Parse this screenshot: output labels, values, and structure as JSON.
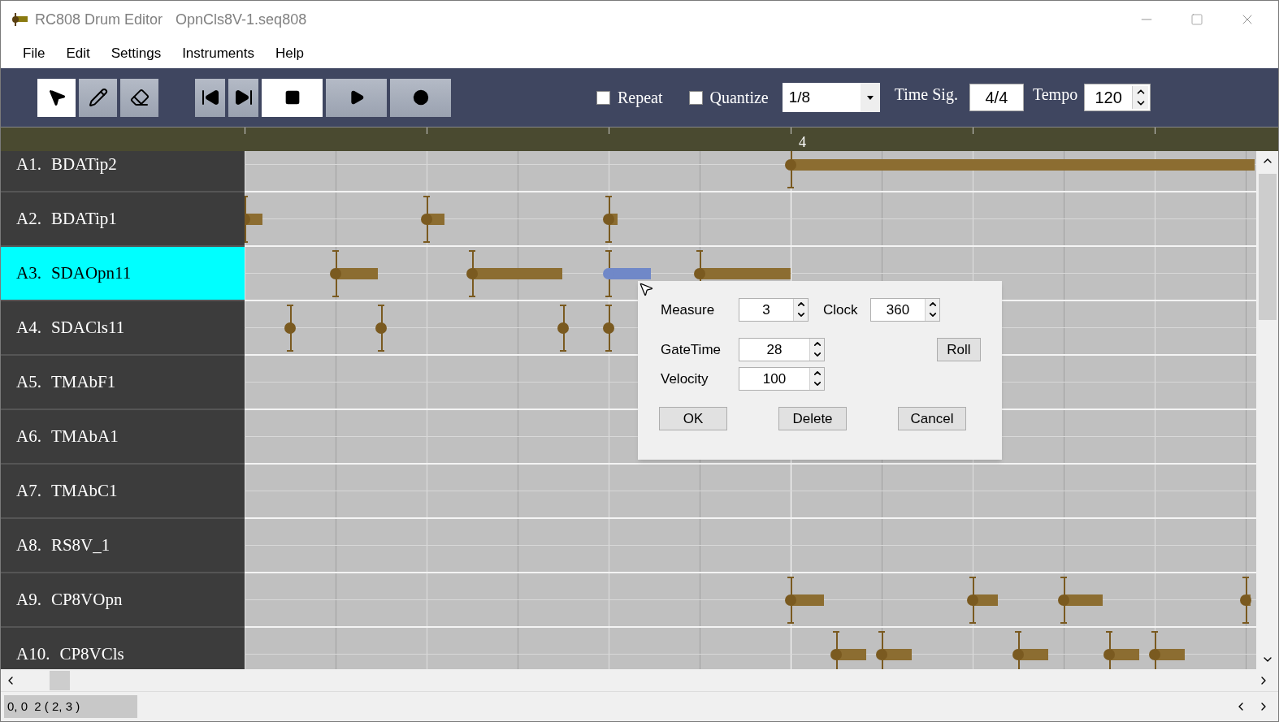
{
  "window": {
    "app_title": "RC808 Drum Editor",
    "file_name": "OpnCls8V-1.seq808"
  },
  "menu": [
    "File",
    "Edit",
    "Settings",
    "Instruments",
    "Help"
  ],
  "tools": [
    {
      "kind": "select",
      "selected": true
    },
    {
      "kind": "pencil",
      "selected": false
    },
    {
      "kind": "eraser",
      "selected": false
    }
  ],
  "transport": [
    {
      "kind": "skip-back",
      "active": false
    },
    {
      "kind": "skip-forward",
      "active": false
    },
    {
      "kind": "stop",
      "active": true
    },
    {
      "kind": "play",
      "active": false
    },
    {
      "kind": "record",
      "active": false
    }
  ],
  "options": [
    {
      "label": "Repeat",
      "checked": false
    },
    {
      "label": "Quantize",
      "checked": false
    }
  ],
  "quantize_value": "1/8",
  "time_sig": {
    "label": "Time Sig.",
    "value": "4/4"
  },
  "tempo": {
    "label": "Tempo",
    "value": "120"
  },
  "measure_label": "4",
  "rows": [
    {
      "id": "A1.",
      "name": "BDATip2",
      "selected": false,
      "notes": [
        {
          "selected": false
        }
      ]
    },
    {
      "id": "A2.",
      "name": "BDATip1",
      "selected": false,
      "notes": [
        {
          "selected": false
        },
        {
          "selected": false
        },
        {
          "selected": false
        }
      ]
    },
    {
      "id": "A3.",
      "name": "SDAOpn11",
      "selected": true,
      "notes": [
        {
          "selected": false
        },
        {
          "selected": false
        },
        {
          "selected": true
        },
        {
          "selected": false
        }
      ]
    },
    {
      "id": "A4.",
      "name": "SDACls11",
      "selected": false,
      "notes": [
        {
          "selected": false
        },
        {
          "selected": false
        },
        {
          "selected": false
        },
        {
          "selected": false
        }
      ]
    },
    {
      "id": "A5.",
      "name": "TMAbF1",
      "selected": false
    },
    {
      "id": "A6.",
      "name": "TMAbA1",
      "selected": false
    },
    {
      "id": "A7.",
      "name": "TMAbC1",
      "selected": false
    },
    {
      "id": "A8.",
      "name": "RS8V_1",
      "selected": false
    },
    {
      "id": "A9.",
      "name": "CP8VOpn",
      "selected": false,
      "notes": [
        {
          "selected": false
        },
        {
          "selected": false
        },
        {
          "selected": false
        },
        {
          "selected": false
        }
      ]
    },
    {
      "id": "A10.",
      "name": "CP8VCls",
      "selected": false,
      "notes": [
        {
          "selected": false
        },
        {
          "selected": false
        },
        {
          "selected": false
        },
        {
          "selected": false
        },
        {
          "selected": false
        }
      ]
    }
  ],
  "dialog": {
    "fields": [
      {
        "label": "Measure",
        "value": "3"
      },
      {
        "label": "Clock",
        "value": "360"
      },
      {
        "label": "GateTime",
        "value": "28"
      },
      {
        "label": "Velocity",
        "value": "100"
      }
    ],
    "roll_button": "Roll",
    "buttons": [
      "OK",
      "Delete",
      "Cancel"
    ]
  },
  "status_bar": "0, 0  2 ( 2, 3 )"
}
